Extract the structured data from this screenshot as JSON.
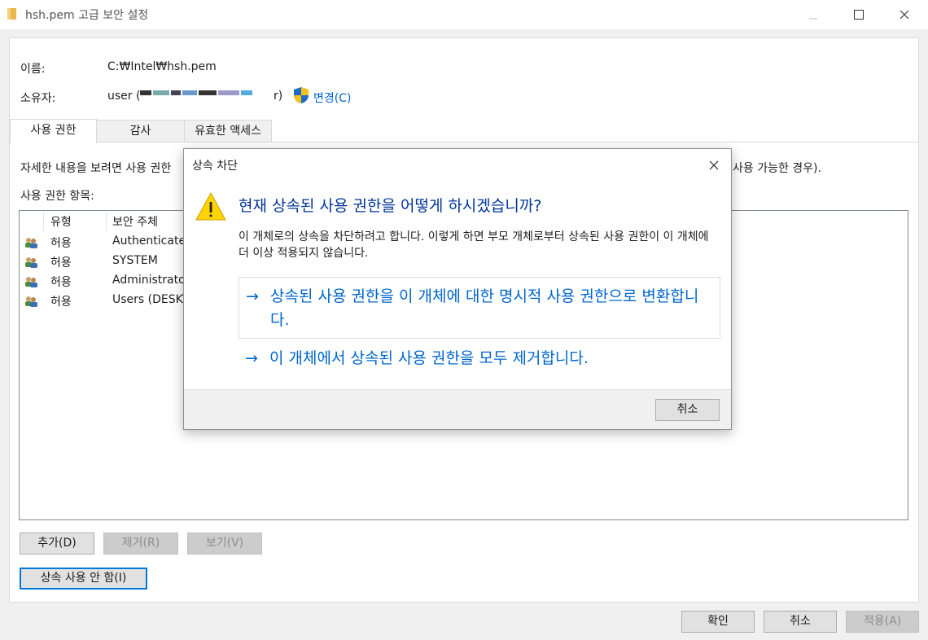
{
  "window": {
    "title": "hsh.pem 고급 보안 설정"
  },
  "info": {
    "name_label": "이름:",
    "name_value": "C:₩Intel₩hsh.pem",
    "owner_label": "소유자:",
    "owner_value_prefix": "user (",
    "owner_value_suffix": "r)",
    "change_link": "변경(C)"
  },
  "tabs": [
    {
      "label": "사용 권한",
      "active": true
    },
    {
      "label": "감사",
      "active": false
    },
    {
      "label": "유효한 액세스",
      "active": false
    }
  ],
  "permissions": {
    "description_left": "자세한 내용을 보려면 사용 권한",
    "description_right": "사용 가능한 경우).",
    "entries_label": "사용 권한 항목:",
    "columns": {
      "type": "유형",
      "principal": "보안 주체"
    },
    "rows": [
      {
        "type": "허용",
        "principal": "Authenticate"
      },
      {
        "type": "허용",
        "principal": "SYSTEM"
      },
      {
        "type": "허용",
        "principal": "Administrato"
      },
      {
        "type": "허용",
        "principal": "Users (DESKT"
      }
    ]
  },
  "buttons": {
    "add": "추가(D)",
    "remove": "제거(R)",
    "view": "보기(V)",
    "disable_inheritance": "상속 사용 안 함(I)",
    "ok": "확인",
    "cancel": "취소",
    "apply": "적용(A)"
  },
  "dialog": {
    "title": "상속 차단",
    "heading": "현재 상속된 사용 권한을 어떻게 하시겠습니까?",
    "description": "이 개체로의 상속을 차단하려고 합니다. 이렇게 하면 부모 개체로부터 상속된 사용 권한이 이 개체에 더 이상 적용되지 않습니다.",
    "option_arrow": "→",
    "option_convert": "상속된 사용 권한을 이 개체에 대한 명시적 사용 권한으로 변환합니다.",
    "option_remove": "이 개체에서 상속된 사용 권한을 모두 제거합니다.",
    "cancel": "취소"
  },
  "icons": {
    "folder": "folder-icon",
    "shield": "uac-shield-icon",
    "warning": "warning-icon",
    "user": "user-group-icon"
  },
  "colors": {
    "link": "#0066cc",
    "heading": "#003399",
    "focus_border": "#0078d7",
    "warning_fill": "#ffd400"
  }
}
